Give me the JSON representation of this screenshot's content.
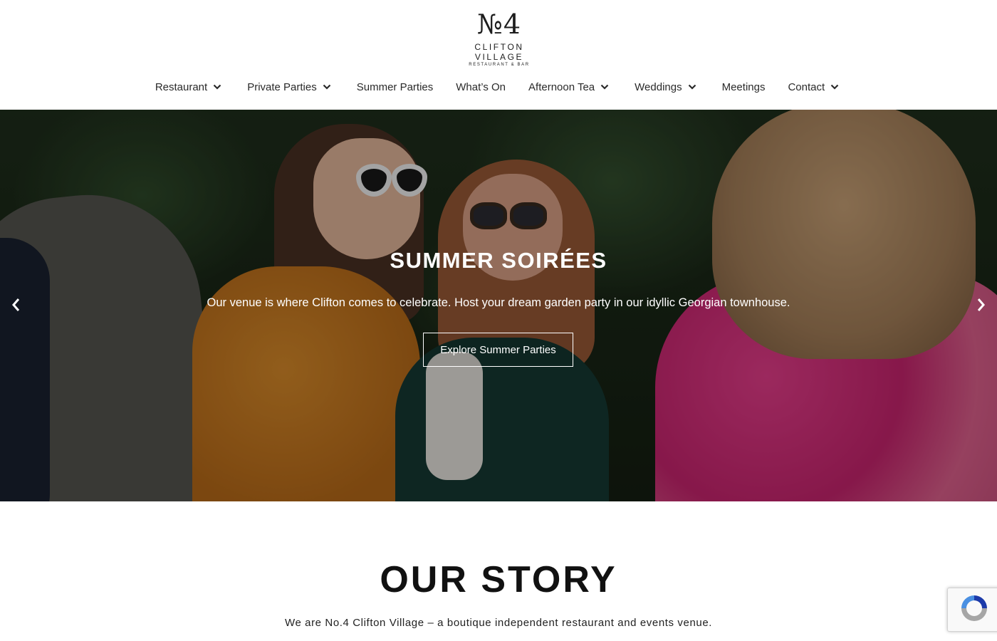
{
  "logo": {
    "mark": "№4",
    "name": "CLIFTON VILLAGE",
    "sub": "RESTAURANT & BAR"
  },
  "nav": {
    "items": [
      {
        "label": "Restaurant",
        "has_dropdown": true
      },
      {
        "label": "Private Parties",
        "has_dropdown": true
      },
      {
        "label": "Summer Parties",
        "has_dropdown": false
      },
      {
        "label": "What’s On",
        "has_dropdown": false
      },
      {
        "label": "Afternoon Tea",
        "has_dropdown": true
      },
      {
        "label": "Weddings",
        "has_dropdown": true
      },
      {
        "label": "Meetings",
        "has_dropdown": false
      },
      {
        "label": "Contact",
        "has_dropdown": true
      }
    ]
  },
  "hero": {
    "title": "SUMMER SOIRÉES",
    "text": "Our venue is where Clifton comes to celebrate. Host your dream garden party in our idyllic Georgian townhouse.",
    "button_label": "Explore Summer Parties",
    "prev_icon": "chevron-left-icon",
    "next_icon": "chevron-right-icon"
  },
  "story": {
    "title": "OUR STORY",
    "text": "We are No.4 Clifton Village – a boutique independent restaurant and events venue."
  },
  "colors": {
    "text": "#2a2a2a",
    "hero_text": "#ffffff",
    "recaptcha_blue": "#1c3aa9",
    "recaptcha_light": "#4a90e2",
    "recaptcha_gray": "#a6a6a6"
  }
}
